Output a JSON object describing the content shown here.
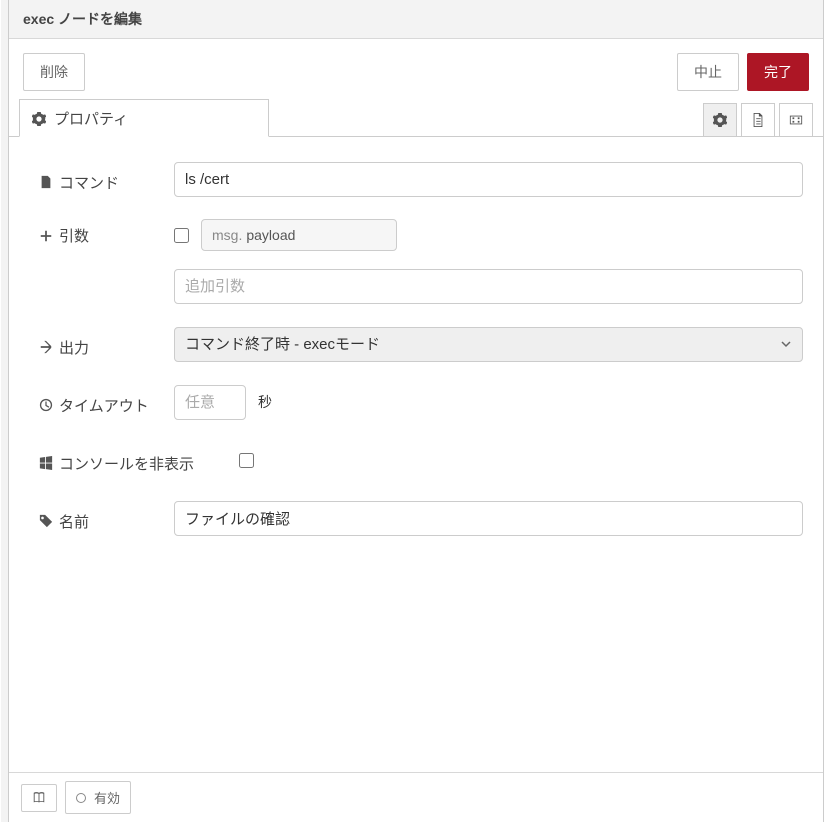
{
  "header": {
    "title": "exec ノードを編集"
  },
  "buttons": {
    "delete": "削除",
    "cancel": "中止",
    "done": "完了"
  },
  "tab": {
    "label": "プロパティ"
  },
  "form": {
    "command": {
      "label": "コマンド",
      "value": "ls /cert"
    },
    "append": {
      "label": "引数",
      "msg_prefix": "msg.",
      "msg_field": "payload",
      "extra_placeholder": "追加引数",
      "extra_value": ""
    },
    "output": {
      "label": "出力",
      "selected": "コマンド終了時 - execモード"
    },
    "timeout": {
      "label": "タイムアウト",
      "placeholder": "任意",
      "value": "",
      "unit": "秒"
    },
    "hideconsole": {
      "label": "コンソールを非表示"
    },
    "name": {
      "label": "名前",
      "value": "ファイルの確認"
    }
  },
  "footer": {
    "enabled": "有効"
  }
}
